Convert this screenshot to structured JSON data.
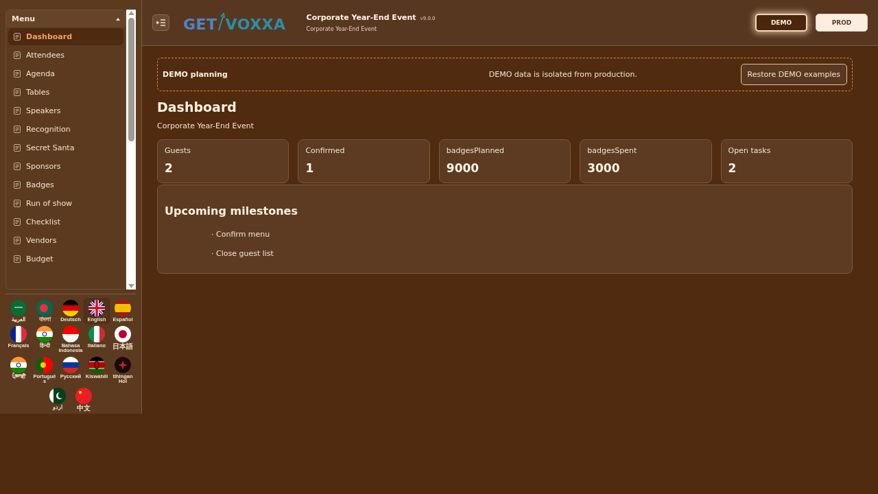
{
  "sidebar": {
    "menu_title": "Menu",
    "expanded": true,
    "items": [
      {
        "label": "Dashboard",
        "selected": true
      },
      {
        "label": "Attendees",
        "selected": false
      },
      {
        "label": "Agenda",
        "selected": false
      },
      {
        "label": "Tables",
        "selected": false
      },
      {
        "label": "Speakers",
        "selected": false
      },
      {
        "label": "Recognition",
        "selected": false
      },
      {
        "label": "Secret Santa",
        "selected": false
      },
      {
        "label": "Sponsors",
        "selected": false
      },
      {
        "label": "Badges",
        "selected": false
      },
      {
        "label": "Run of show",
        "selected": false
      },
      {
        "label": "Checklist",
        "selected": false
      },
      {
        "label": "Vendors",
        "selected": false
      },
      {
        "label": "Budget",
        "selected": false
      }
    ],
    "languages": [
      {
        "label": "العربية",
        "selected": false
      },
      {
        "label": "বাংলা",
        "selected": false
      },
      {
        "label": "Deutsch",
        "selected": false
      },
      {
        "label": "English",
        "selected": true
      },
      {
        "label": "Español",
        "selected": false
      },
      {
        "label": "Français",
        "selected": false
      },
      {
        "label": "हिन्दी",
        "selected": false
      },
      {
        "label": "Bahasa Indonesia",
        "selected": false
      },
      {
        "label": "Italiano",
        "selected": false
      },
      {
        "label": "日本語",
        "selected": false
      },
      {
        "label": "ਪੰਜਾਬੀ",
        "selected": false
      },
      {
        "label": "Português",
        "selected": false
      },
      {
        "label": "Русский",
        "selected": false
      },
      {
        "label": "Kiswahili",
        "selected": false
      },
      {
        "label": "tlhIngan Hol",
        "selected": false
      },
      {
        "label": "اردو",
        "selected": false
      },
      {
        "label": "中文",
        "selected": false
      }
    ]
  },
  "header": {
    "logo": {
      "left": "GET",
      "right": "VOXXA"
    },
    "title": "Corporate Year-End Event",
    "version": "v9.0.0",
    "subtitle": "Corporate Year-End Event",
    "environments": [
      {
        "label": "DEMO",
        "selected": true
      },
      {
        "label": "PROD",
        "selected": false
      }
    ]
  },
  "banner": {
    "title": "DEMO planning",
    "message": "DEMO data is isolated from production.",
    "button": "Restore DEMO examples"
  },
  "page": {
    "title": "Dashboard",
    "subtitle": "Corporate Year-End Event"
  },
  "stats": [
    {
      "label": "Guests",
      "value": "2"
    },
    {
      "label": "Confirmed",
      "value": "1"
    },
    {
      "label": "badgesPlanned",
      "value": "9000"
    },
    {
      "label": "badgesSpent",
      "value": "3000"
    },
    {
      "label": "Open tasks",
      "value": "2"
    }
  ],
  "milestones": {
    "title": "Upcoming milestones",
    "items": [
      "· Confirm menu",
      "· Close guest list"
    ]
  }
}
